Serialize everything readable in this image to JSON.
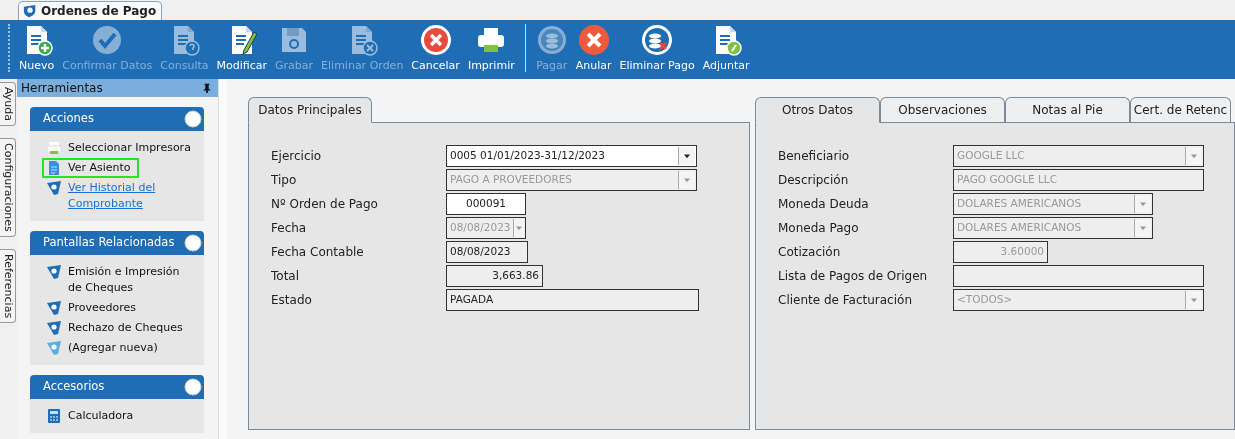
{
  "document_tab": {
    "title": "Ordenes de Pago",
    "selected": true
  },
  "toolbar": {
    "groups": [
      {
        "buttons": [
          {
            "label": "Nuevo",
            "kind": "new",
            "disabled": false
          },
          {
            "label": "Confirmar Datos",
            "kind": "confirm",
            "disabled": true
          },
          {
            "label": "Consulta",
            "kind": "query",
            "disabled": true
          },
          {
            "label": "Modificar",
            "kind": "edit",
            "disabled": false
          },
          {
            "label": "Grabar",
            "kind": "save",
            "disabled": true
          },
          {
            "label": "Eliminar Orden",
            "kind": "delete-doc",
            "disabled": true
          },
          {
            "label": "Cancelar",
            "kind": "cancel",
            "disabled": false
          },
          {
            "label": "Imprimir",
            "kind": "print",
            "disabled": false
          }
        ]
      },
      {
        "buttons": [
          {
            "label": "Pagar",
            "kind": "pay",
            "disabled": true
          },
          {
            "label": "Anular",
            "kind": "void",
            "disabled": false
          },
          {
            "label": "Eliminar Pago",
            "kind": "delete-pay",
            "disabled": false
          },
          {
            "label": "Adjuntar",
            "kind": "attach",
            "disabled": false
          }
        ]
      }
    ]
  },
  "side_tabs": [
    {
      "label": "Ayuda"
    },
    {
      "label": "Configuraciones"
    },
    {
      "label": "Referencias"
    }
  ],
  "sidebar": {
    "title": "Herramientas",
    "sections": [
      {
        "title": "Acciones",
        "items": [
          {
            "label": "Seleccionar Impresora",
            "kind": "printer",
            "highlighted": false,
            "link": false
          },
          {
            "label": "Ver Asiento",
            "kind": "document",
            "highlighted": true,
            "link": false
          },
          {
            "label": "Ver Historial del Comprobante",
            "kind": "screen",
            "highlighted": false,
            "link": true
          }
        ]
      },
      {
        "title": "Pantallas Relacionadas",
        "items": [
          {
            "label": "Emisión e Impresión de Cheques",
            "kind": "screen",
            "highlighted": false,
            "link": false
          },
          {
            "label": "Proveedores",
            "kind": "screen",
            "highlighted": false,
            "link": false
          },
          {
            "label": "Rechazo de Cheques",
            "kind": "screen",
            "highlighted": false,
            "link": false
          },
          {
            "label": "(Agregar nueva)",
            "kind": "screen-new",
            "highlighted": false,
            "link": false
          }
        ]
      },
      {
        "title": "Accesorios",
        "items": [
          {
            "label": "Calculadora",
            "kind": "calculator"
          }
        ]
      }
    ]
  },
  "main_panel": {
    "tabs": [
      {
        "label": "Datos Principales",
        "selected": true
      }
    ],
    "fields": [
      {
        "label": "Ejercicio",
        "value": "0005 01/01/2023-31/12/2023",
        "kind": "combo",
        "editable": true,
        "disabled": false
      },
      {
        "label": "Tipo",
        "value": "PAGO A PROVEEDORES",
        "kind": "combo",
        "editable": false,
        "disabled": true
      },
      {
        "label": "Nº Orden de Pago",
        "value": "000091",
        "kind": "text",
        "editable": true,
        "disabled": false
      },
      {
        "label": "Fecha",
        "value": "08/08/2023",
        "kind": "combo",
        "editable": false,
        "disabled": true
      },
      {
        "label": "Fecha Contable",
        "value": "08/08/2023",
        "kind": "text",
        "editable": false,
        "disabled": false
      },
      {
        "label": "Total",
        "value": "3,663.86",
        "kind": "text",
        "editable": false,
        "disabled": false
      },
      {
        "label": "Estado",
        "value": "PAGADA",
        "kind": "text",
        "editable": false,
        "disabled": false
      }
    ]
  },
  "other_panel": {
    "tabs": [
      {
        "label": "Otros Datos",
        "selected": true
      },
      {
        "label": "Observaciones",
        "selected": false
      },
      {
        "label": "Notas al Pie",
        "selected": false
      },
      {
        "label": "Cert. de Retenc",
        "selected": false
      }
    ],
    "fields": [
      {
        "label": "Beneficiario",
        "value": "GOOGLE LLC",
        "kind": "combo",
        "editable": false,
        "disabled": true
      },
      {
        "label": "Descripción",
        "value": "PAGO GOOGLE LLC",
        "kind": "text",
        "editable": false,
        "disabled": true
      },
      {
        "label": "Moneda Deuda",
        "value": "DOLARES AMERICANOS",
        "kind": "combo",
        "editable": false,
        "disabled": true
      },
      {
        "label": "Moneda Pago",
        "value": "DOLARES AMERICANOS",
        "kind": "combo",
        "editable": false,
        "disabled": true
      },
      {
        "label": "Cotización",
        "value": "3.60000",
        "kind": "text",
        "editable": false,
        "disabled": true
      },
      {
        "label": "Lista de Pagos de Origen",
        "kind": "text",
        "editable": false
      },
      {
        "label": "Cliente de Facturación",
        "value": "<TODOS>",
        "kind": "combo",
        "editable": false,
        "disabled": true
      }
    ]
  }
}
